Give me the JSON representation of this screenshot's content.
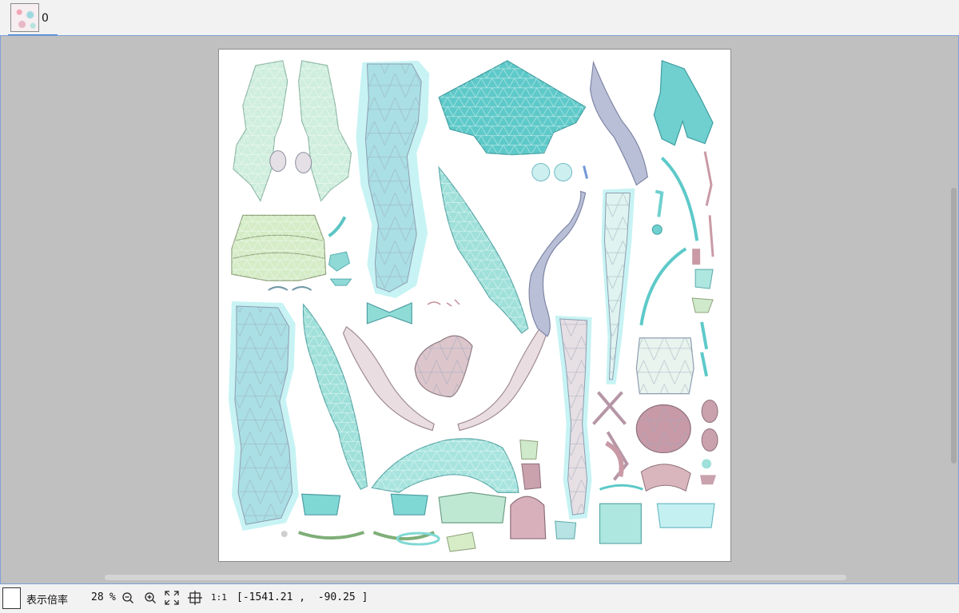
{
  "tabs": [
    {
      "label": "0",
      "selected": true
    }
  ],
  "statusbar": {
    "zoom_label": "表示倍率",
    "zoom_value": "28",
    "zoom_unit": "%",
    "one_to_one": "1:1",
    "coord_open": "[",
    "coord_x": "-1541.21",
    "coord_sep": ",",
    "coord_y": "-90.25",
    "coord_close": "]"
  },
  "colors": {
    "teal": "#56c7c7",
    "mint": "#b9ecd8",
    "light_cyan": "#c8f3f4",
    "pink": "#c99aa6",
    "accent": "#3a7bd5"
  },
  "icons": {
    "zoom_out": "zoom-out-icon",
    "zoom_in": "zoom-in-icon",
    "fit": "fit-screen-icon",
    "center": "crosshair-icon"
  }
}
